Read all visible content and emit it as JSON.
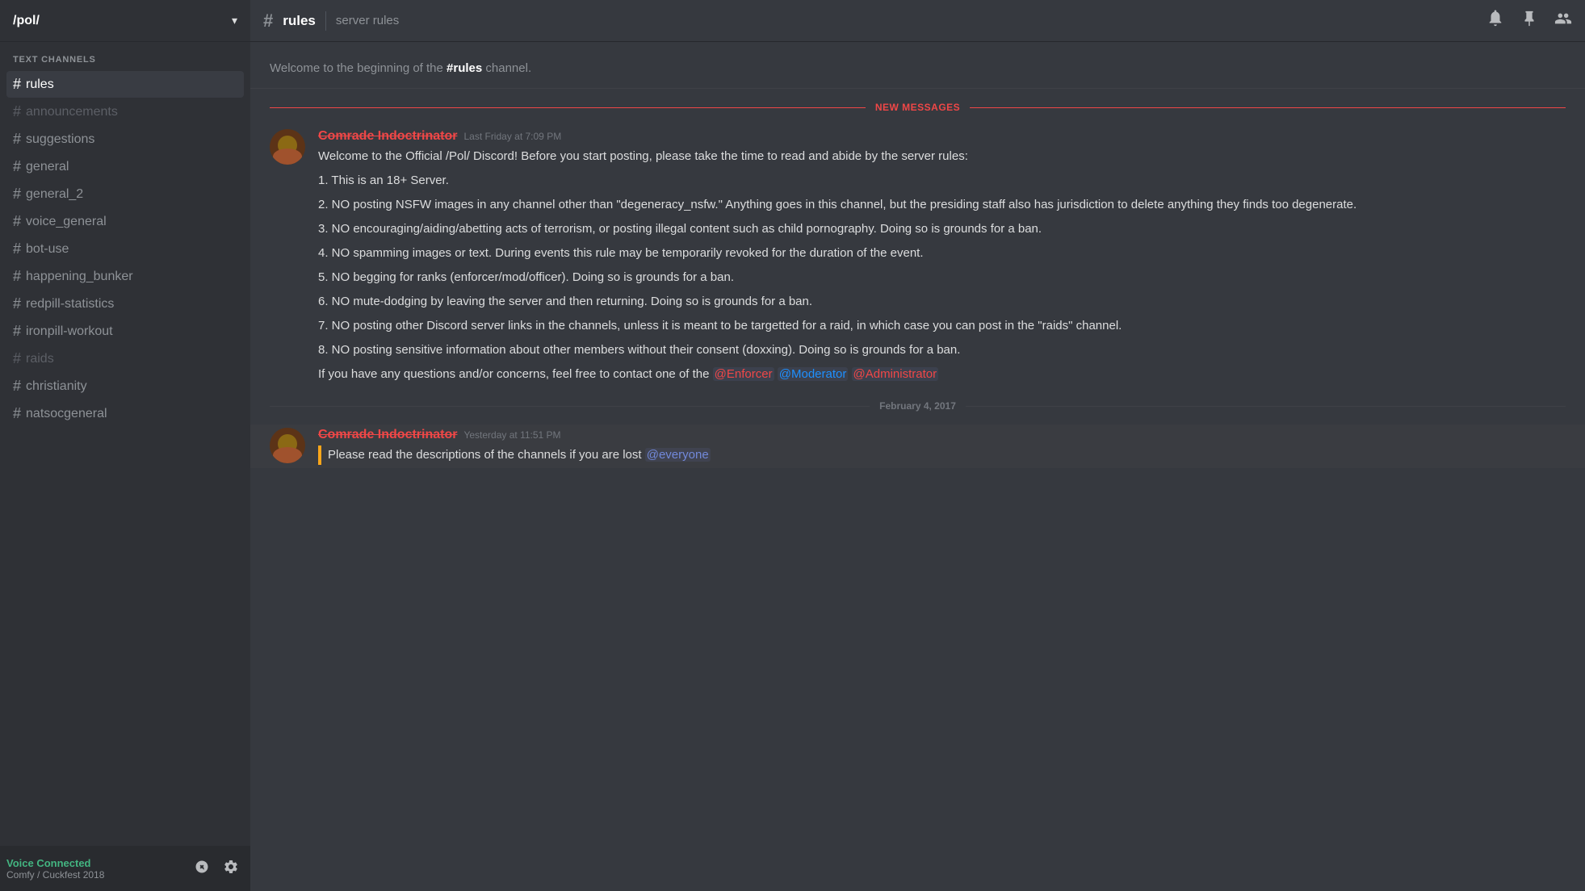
{
  "server": {
    "name": "/pol/",
    "chevron": "▾"
  },
  "sidebar": {
    "section_label": "TEXT CHANNELS",
    "channels": [
      {
        "id": "rules",
        "name": "rules",
        "active": true,
        "muted": false
      },
      {
        "id": "announcements",
        "name": "announcements",
        "active": false,
        "muted": true
      },
      {
        "id": "suggestions",
        "name": "suggestions",
        "active": false,
        "muted": false
      },
      {
        "id": "general",
        "name": "general",
        "active": false,
        "muted": false
      },
      {
        "id": "general_2",
        "name": "general_2",
        "active": false,
        "muted": false
      },
      {
        "id": "voice_general",
        "name": "voice_general",
        "active": false,
        "muted": false
      },
      {
        "id": "bot-use",
        "name": "bot-use",
        "active": false,
        "muted": false
      },
      {
        "id": "happening_bunker",
        "name": "happening_bunker",
        "active": false,
        "muted": false
      },
      {
        "id": "redpill-statistics",
        "name": "redpill-statistics",
        "active": false,
        "muted": false
      },
      {
        "id": "ironpill-workout",
        "name": "ironpill-workout",
        "active": false,
        "muted": false
      },
      {
        "id": "raids",
        "name": "raids",
        "active": false,
        "muted": true
      },
      {
        "id": "christianity",
        "name": "christianity",
        "active": false,
        "muted": false
      },
      {
        "id": "natsocgeneral",
        "name": "natsocgeneral",
        "active": false,
        "muted": false
      }
    ],
    "voice_connected": {
      "label": "Voice Connected",
      "channel": "Comfy / Cuckfest 2018"
    }
  },
  "channel_header": {
    "hash": "#",
    "name": "rules",
    "topic": "server rules"
  },
  "messages_area": {
    "beginning_text": "Welcome to the beginning of the ",
    "beginning_channel": "#rules",
    "beginning_end": " channel.",
    "new_messages_label": "NEW MESSAGES",
    "messages": [
      {
        "id": "msg1",
        "username": "Comrade Indoctrinator",
        "timestamp": "Last Friday at 7:09 PM",
        "lines": [
          "Welcome to the Official /Pol/ Discord! Before you start posting, please take the time to read and abide by the server rules:",
          "",
          "1. This is an 18+ Server.",
          "",
          "2. NO posting NSFW images in any channel other than \"degeneracy_nsfw.\" Anything goes in this channel, but the presiding staff also has jurisdiction to delete anything they finds too degenerate.",
          "",
          "3. NO encouraging/aiding/abetting acts of terrorism, or posting illegal content such as child pornography. Doing so is grounds for a ban.",
          "",
          "4. NO spamming images or text. During events this rule may be temporarily revoked for the duration of the event.",
          "",
          "5. NO begging for ranks (enforcer/mod/officer). Doing so is grounds for a ban.",
          "",
          "6. NO mute-dodging by leaving the server and then returning. Doing so is grounds for a ban.",
          "",
          "7. NO posting other Discord server links in the channels, unless it is meant to be targetted for a raid, in which case you can post in the \"raids\" channel.",
          "",
          "8. NO posting sensitive information about other members without their consent (doxxing). Doing so is grounds for a ban.",
          "",
          "If you have any questions and/or concerns, feel free to contact one of the "
        ],
        "mentions": [
          {
            "label": "@Enforcer",
            "class": "enforcer"
          },
          {
            "label": "@Moderator",
            "class": "moderator"
          },
          {
            "label": "@Administrator",
            "class": "administrator"
          }
        ]
      }
    ],
    "date_divider": "February 4, 2017",
    "second_message": {
      "username": "Comrade Indoctrinator",
      "timestamp": "Yesterday at 11:51 PM",
      "text": "Please read the descriptions of the channels if you are lost ",
      "mention": "@everyone"
    }
  }
}
